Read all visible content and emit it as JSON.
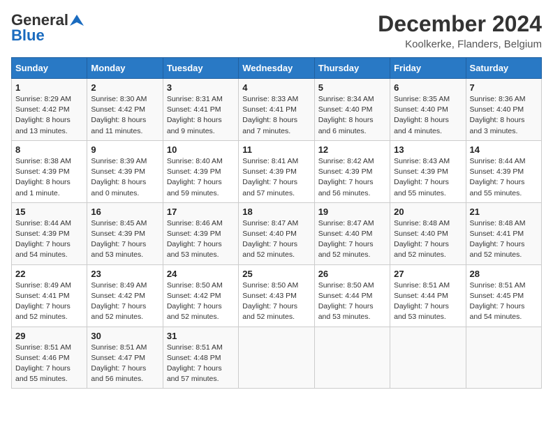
{
  "logo": {
    "line1": "General",
    "line2": "Blue"
  },
  "title": "December 2024",
  "location": "Koolkerke, Flanders, Belgium",
  "weekdays": [
    "Sunday",
    "Monday",
    "Tuesday",
    "Wednesday",
    "Thursday",
    "Friday",
    "Saturday"
  ],
  "weeks": [
    [
      {
        "day": "1",
        "info": "Sunrise: 8:29 AM\nSunset: 4:42 PM\nDaylight: 8 hours\nand 13 minutes."
      },
      {
        "day": "2",
        "info": "Sunrise: 8:30 AM\nSunset: 4:42 PM\nDaylight: 8 hours\nand 11 minutes."
      },
      {
        "day": "3",
        "info": "Sunrise: 8:31 AM\nSunset: 4:41 PM\nDaylight: 8 hours\nand 9 minutes."
      },
      {
        "day": "4",
        "info": "Sunrise: 8:33 AM\nSunset: 4:41 PM\nDaylight: 8 hours\nand 7 minutes."
      },
      {
        "day": "5",
        "info": "Sunrise: 8:34 AM\nSunset: 4:40 PM\nDaylight: 8 hours\nand 6 minutes."
      },
      {
        "day": "6",
        "info": "Sunrise: 8:35 AM\nSunset: 4:40 PM\nDaylight: 8 hours\nand 4 minutes."
      },
      {
        "day": "7",
        "info": "Sunrise: 8:36 AM\nSunset: 4:40 PM\nDaylight: 8 hours\nand 3 minutes."
      }
    ],
    [
      {
        "day": "8",
        "info": "Sunrise: 8:38 AM\nSunset: 4:39 PM\nDaylight: 8 hours\nand 1 minute."
      },
      {
        "day": "9",
        "info": "Sunrise: 8:39 AM\nSunset: 4:39 PM\nDaylight: 8 hours\nand 0 minutes."
      },
      {
        "day": "10",
        "info": "Sunrise: 8:40 AM\nSunset: 4:39 PM\nDaylight: 7 hours\nand 59 minutes."
      },
      {
        "day": "11",
        "info": "Sunrise: 8:41 AM\nSunset: 4:39 PM\nDaylight: 7 hours\nand 57 minutes."
      },
      {
        "day": "12",
        "info": "Sunrise: 8:42 AM\nSunset: 4:39 PM\nDaylight: 7 hours\nand 56 minutes."
      },
      {
        "day": "13",
        "info": "Sunrise: 8:43 AM\nSunset: 4:39 PM\nDaylight: 7 hours\nand 55 minutes."
      },
      {
        "day": "14",
        "info": "Sunrise: 8:44 AM\nSunset: 4:39 PM\nDaylight: 7 hours\nand 55 minutes."
      }
    ],
    [
      {
        "day": "15",
        "info": "Sunrise: 8:44 AM\nSunset: 4:39 PM\nDaylight: 7 hours\nand 54 minutes."
      },
      {
        "day": "16",
        "info": "Sunrise: 8:45 AM\nSunset: 4:39 PM\nDaylight: 7 hours\nand 53 minutes."
      },
      {
        "day": "17",
        "info": "Sunrise: 8:46 AM\nSunset: 4:39 PM\nDaylight: 7 hours\nand 53 minutes."
      },
      {
        "day": "18",
        "info": "Sunrise: 8:47 AM\nSunset: 4:40 PM\nDaylight: 7 hours\nand 52 minutes."
      },
      {
        "day": "19",
        "info": "Sunrise: 8:47 AM\nSunset: 4:40 PM\nDaylight: 7 hours\nand 52 minutes."
      },
      {
        "day": "20",
        "info": "Sunrise: 8:48 AM\nSunset: 4:40 PM\nDaylight: 7 hours\nand 52 minutes."
      },
      {
        "day": "21",
        "info": "Sunrise: 8:48 AM\nSunset: 4:41 PM\nDaylight: 7 hours\nand 52 minutes."
      }
    ],
    [
      {
        "day": "22",
        "info": "Sunrise: 8:49 AM\nSunset: 4:41 PM\nDaylight: 7 hours\nand 52 minutes."
      },
      {
        "day": "23",
        "info": "Sunrise: 8:49 AM\nSunset: 4:42 PM\nDaylight: 7 hours\nand 52 minutes."
      },
      {
        "day": "24",
        "info": "Sunrise: 8:50 AM\nSunset: 4:42 PM\nDaylight: 7 hours\nand 52 minutes."
      },
      {
        "day": "25",
        "info": "Sunrise: 8:50 AM\nSunset: 4:43 PM\nDaylight: 7 hours\nand 52 minutes."
      },
      {
        "day": "26",
        "info": "Sunrise: 8:50 AM\nSunset: 4:44 PM\nDaylight: 7 hours\nand 53 minutes."
      },
      {
        "day": "27",
        "info": "Sunrise: 8:51 AM\nSunset: 4:44 PM\nDaylight: 7 hours\nand 53 minutes."
      },
      {
        "day": "28",
        "info": "Sunrise: 8:51 AM\nSunset: 4:45 PM\nDaylight: 7 hours\nand 54 minutes."
      }
    ],
    [
      {
        "day": "29",
        "info": "Sunrise: 8:51 AM\nSunset: 4:46 PM\nDaylight: 7 hours\nand 55 minutes."
      },
      {
        "day": "30",
        "info": "Sunrise: 8:51 AM\nSunset: 4:47 PM\nDaylight: 7 hours\nand 56 minutes."
      },
      {
        "day": "31",
        "info": "Sunrise: 8:51 AM\nSunset: 4:48 PM\nDaylight: 7 hours\nand 57 minutes."
      },
      {
        "day": "",
        "info": ""
      },
      {
        "day": "",
        "info": ""
      },
      {
        "day": "",
        "info": ""
      },
      {
        "day": "",
        "info": ""
      }
    ]
  ]
}
